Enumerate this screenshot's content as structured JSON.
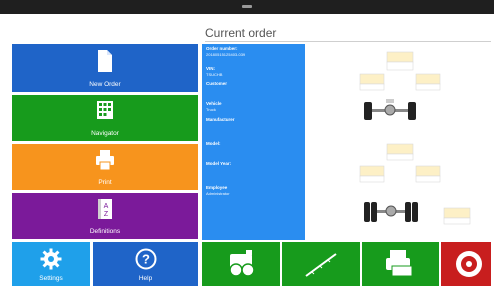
{
  "header": {
    "title": "Current order"
  },
  "tiles": {
    "new_order": "New Order",
    "navigator": "Navigator",
    "print": "Print",
    "definitions": "Definitions",
    "settings": "Settings",
    "help": "Help"
  },
  "order_info": {
    "order_number_label": "Order number:",
    "order_number_value": "20180515125403-039",
    "vin_label": "VIN:",
    "vin_value": "TSUCHB",
    "customer_label": "Customer",
    "vehicle_label": "Vehicle",
    "vehicle_value": "Truck",
    "manufacturer_label": "Manufacturer",
    "model_label": "Model:",
    "model_year_label": "Model Year:",
    "employee_label": "Employee",
    "employee_value": "Administrator"
  },
  "bottom_actions": [
    {
      "name": "measure",
      "icon": "camera-head-icon"
    },
    {
      "name": "align",
      "icon": "ruler-icon"
    },
    {
      "name": "print-report",
      "icon": "printer-car-icon"
    },
    {
      "name": "tires",
      "icon": "wheel-icon"
    }
  ],
  "colors": {
    "blue": "#1f64c8",
    "green": "#179b1c",
    "orange": "#f7941d",
    "purple": "#7b1a9a",
    "lightblue": "#1fa0ea",
    "info_blue": "#2a8df0",
    "red": "#c81e1e"
  }
}
